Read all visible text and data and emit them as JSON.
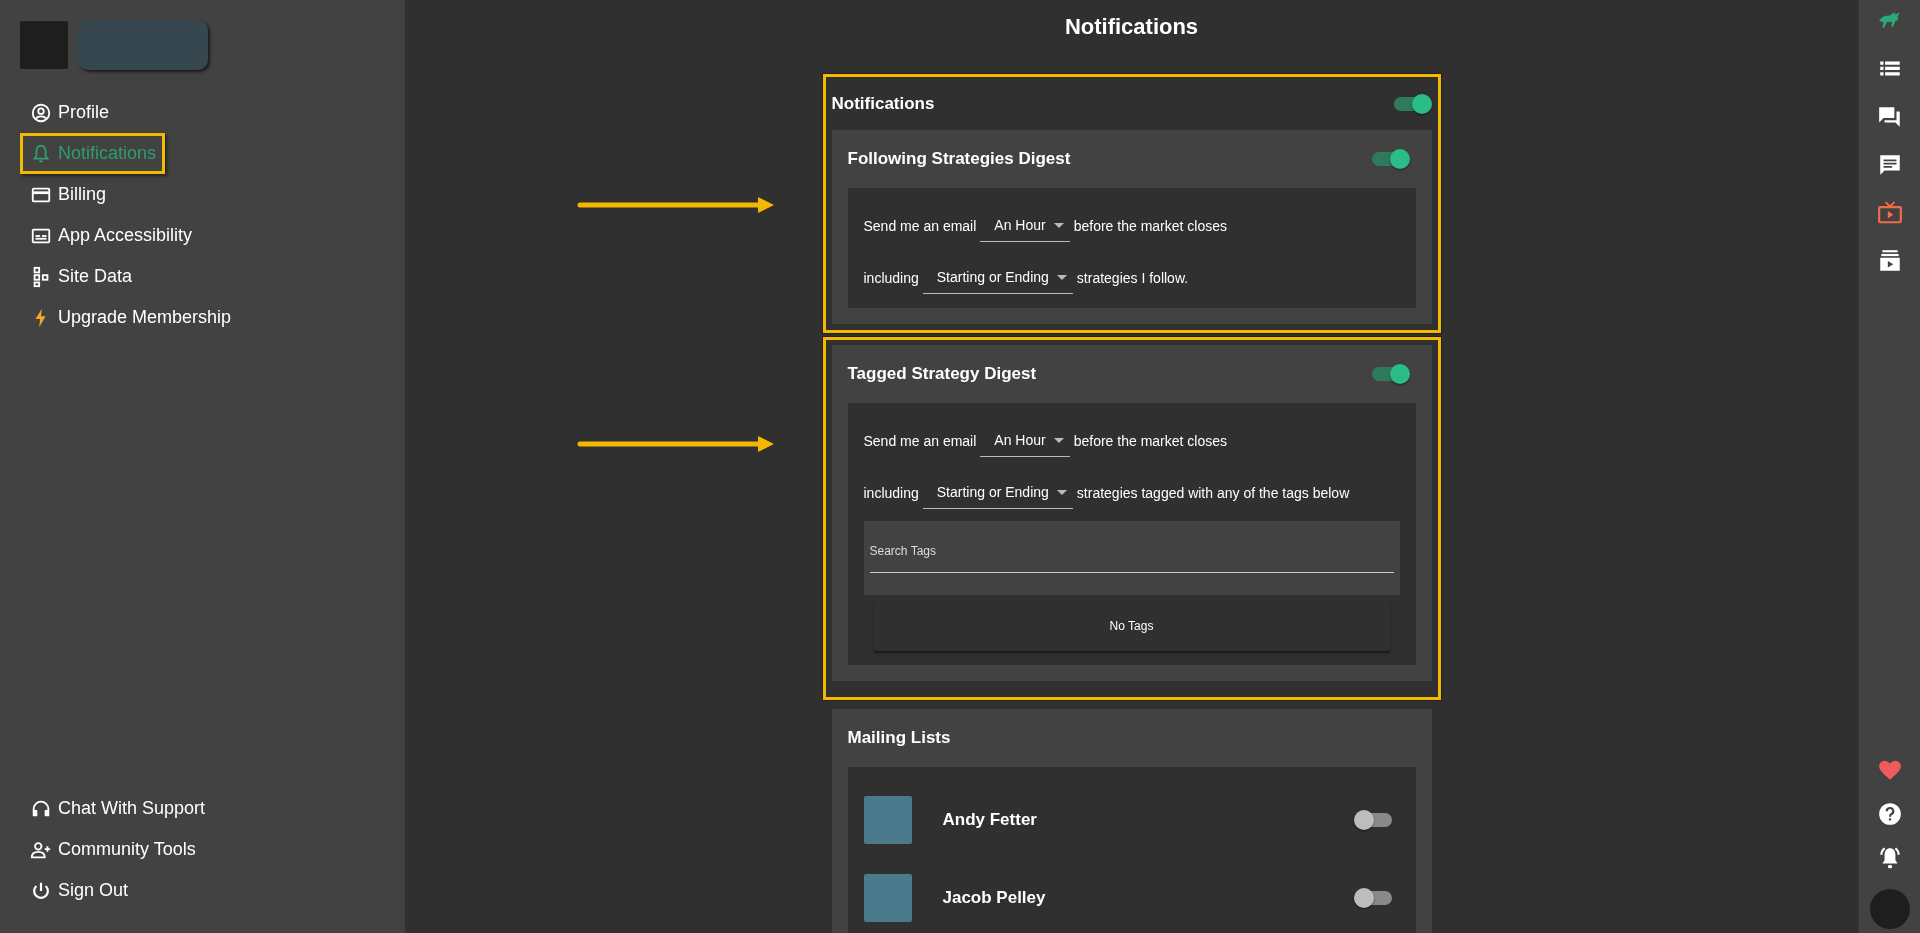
{
  "sidebar": {
    "nav": [
      {
        "label": "Profile",
        "kind": "profile",
        "selected": false,
        "highlighted": false
      },
      {
        "label": "Notifications",
        "kind": "bell",
        "selected": true,
        "highlighted": true
      },
      {
        "label": "Billing",
        "kind": "card",
        "selected": false,
        "highlighted": false
      },
      {
        "label": "App Accessibility",
        "kind": "captions",
        "selected": false,
        "highlighted": false
      },
      {
        "label": "Site Data",
        "kind": "tree",
        "selected": false,
        "highlighted": false
      },
      {
        "label": "Upgrade Membership",
        "kind": "bolt",
        "selected": false,
        "highlighted": false
      }
    ],
    "footer_nav": [
      {
        "label": "Chat With Support",
        "kind": "headset"
      },
      {
        "label": "Community Tools",
        "kind": "people"
      },
      {
        "label": "Sign Out",
        "kind": "power"
      }
    ]
  },
  "page_title": "Notifications",
  "notifications": {
    "title": "Notifications",
    "on": true,
    "digests": [
      {
        "title": "Following Strategies Digest",
        "on": true,
        "highlighted": true,
        "rows": [
          {
            "before": "Send me an email",
            "select": "An Hour",
            "after": "before the market closes"
          },
          {
            "before": "including",
            "select": "Starting or Ending",
            "after": "strategies I follow."
          }
        ]
      },
      {
        "title": "Tagged Strategy Digest",
        "on": true,
        "highlighted": true,
        "rows": [
          {
            "before": "Send me an email",
            "select": "An Hour",
            "after": "before the market closes"
          },
          {
            "before": "including",
            "select": "Starting or Ending",
            "after": "strategies tagged with any of the tags below"
          }
        ],
        "tags": {
          "placeholder": "Search Tags",
          "empty": "No Tags"
        }
      }
    ]
  },
  "mailing_lists": {
    "title": "Mailing Lists",
    "people": [
      {
        "name": "Andy Fetter",
        "on": false
      },
      {
        "name": "Jacob Pelley",
        "on": false
      }
    ]
  },
  "rail": [
    {
      "kind": "bull",
      "selected": false
    },
    {
      "kind": "list",
      "selected": false
    },
    {
      "kind": "forum",
      "selected": false
    },
    {
      "kind": "comment",
      "selected": false
    },
    {
      "kind": "tv",
      "selected": true
    },
    {
      "kind": "playlist",
      "selected": false
    }
  ],
  "rail_bottom": [
    {
      "kind": "heart"
    },
    {
      "kind": "help"
    },
    {
      "kind": "bell"
    },
    {
      "kind": "avatar"
    }
  ]
}
